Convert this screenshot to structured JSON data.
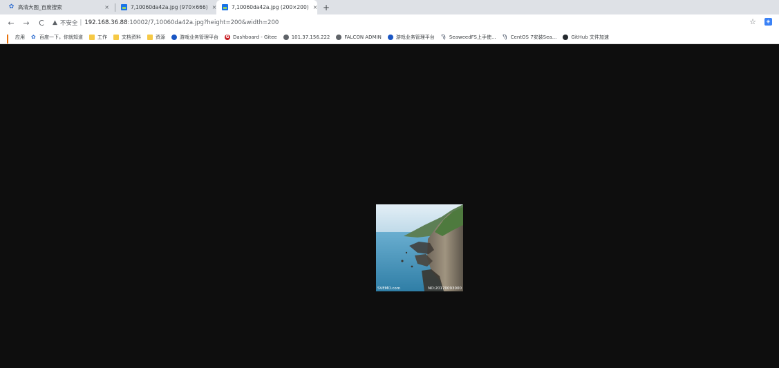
{
  "tabs": [
    {
      "title": "高清大图_百度搜索",
      "close": "×",
      "icon": "paw-icon"
    },
    {
      "title": "7,10060da42a.jpg (970×666)",
      "close": "×",
      "icon": "image-icon"
    },
    {
      "title": "7,10060da42a.jpg (200×200)",
      "close": "×",
      "icon": "image-icon",
      "active": true
    }
  ],
  "new_tab": "+",
  "toolbar": {
    "back": "←",
    "forward": "→",
    "reload": "C",
    "warning": "▲",
    "insecure_label": "不安全",
    "separator": "|",
    "url_host": "192.168.36.88",
    "url_rest": ":10002/7,10060da42a.jpg?height=200&width=200",
    "star": "☆",
    "extension": "◈"
  },
  "bookmarks": [
    {
      "label": "应用",
      "icon": "apps-icon"
    },
    {
      "label": "百度一下，你就知道",
      "icon": "paw-icon"
    },
    {
      "label": "工作",
      "icon": "folder-icon"
    },
    {
      "label": "文档资料",
      "icon": "folder-icon"
    },
    {
      "label": "资源",
      "icon": "folder-icon"
    },
    {
      "label": "游戏业务管理平台",
      "icon": "globe-icon"
    },
    {
      "label": "Dashboard - Gitee",
      "icon": "gitee-icon"
    },
    {
      "label": "101.37.156.222",
      "icon": "globe-icon"
    },
    {
      "label": "FALCON ADMIN",
      "icon": "globe-icon"
    },
    {
      "label": "游戏业务管理平台",
      "icon": "globe-icon"
    },
    {
      "label": "SeaweedFS上手使...",
      "icon": "seaweed-icon"
    },
    {
      "label": "CentOS 7安装Sea...",
      "icon": "seaweed-icon"
    },
    {
      "label": "GitHub 文件加速",
      "icon": "github-icon"
    }
  ],
  "image": {
    "watermark_left": "SVEMO.com",
    "watermark_right": "NO:20170093000",
    "colors": {
      "sky": "#cfe3ee",
      "sea": "#4a93b8",
      "cliff": "#8a7e6e",
      "foliage": "#4e7a3e"
    }
  }
}
